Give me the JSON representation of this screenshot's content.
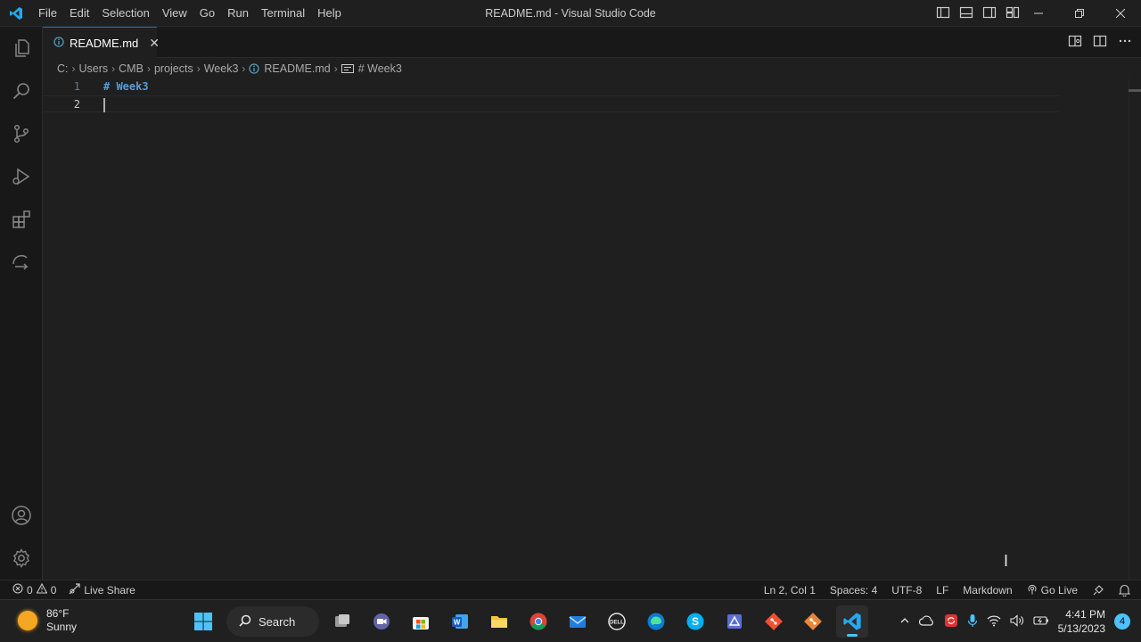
{
  "titlebar": {
    "title": "README.md - Visual Studio Code",
    "menu": [
      "File",
      "Edit",
      "Selection",
      "View",
      "Go",
      "Run",
      "Terminal",
      "Help"
    ]
  },
  "tab": {
    "label": "README.md"
  },
  "breadcrumb": {
    "parts": [
      "C:",
      "Users",
      "CMB",
      "projects",
      "Week3",
      "README.md",
      "# Week3"
    ]
  },
  "editor": {
    "lines": [
      {
        "number": "1",
        "text": "# Week3"
      },
      {
        "number": "2",
        "text": ""
      }
    ]
  },
  "statusbar": {
    "errors": "0",
    "warnings": "0",
    "live_share": "Live Share",
    "position": "Ln 2, Col 1",
    "spaces": "Spaces: 4",
    "encoding": "UTF-8",
    "eol": "LF",
    "language": "Markdown",
    "go_live": "Go Live"
  },
  "taskbar": {
    "weather_temp": "86°F",
    "weather_desc": "Sunny",
    "search_label": "Search",
    "time": "4:41 PM",
    "date": "5/13/2023",
    "notifications": "4"
  },
  "colors": {
    "accent": "#0078d4",
    "heading": "#569cd6",
    "editor_bg": "#1f1f1f"
  }
}
